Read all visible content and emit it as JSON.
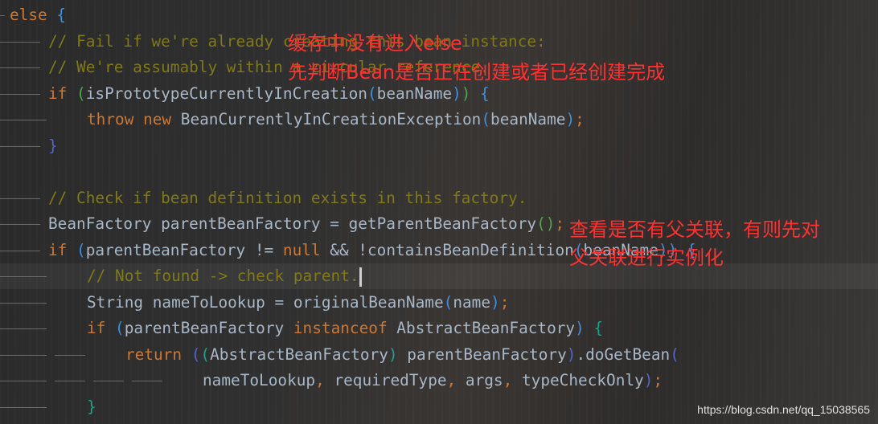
{
  "editor": {
    "current_line": 10,
    "lines": [
      {
        "indent": 0,
        "tokens": [
          [
            "kw",
            "else"
          ],
          [
            "op",
            " "
          ],
          [
            "b1",
            "{"
          ]
        ]
      },
      {
        "indent": 1,
        "tokens": [
          [
            "cm",
            "// Fail if we're already creating this bean instance:"
          ]
        ]
      },
      {
        "indent": 1,
        "tokens": [
          [
            "cm",
            "// We're assumably within a circular reference."
          ]
        ]
      },
      {
        "indent": 1,
        "tokens": [
          [
            "kw",
            "if"
          ],
          [
            "op",
            " "
          ],
          [
            "b2",
            "("
          ],
          [
            "id",
            "isPrototypeCurrentlyInCreation"
          ],
          [
            "b1",
            "("
          ],
          [
            "id",
            "beanName"
          ],
          [
            "b1",
            ")"
          ],
          [
            "b2",
            ")"
          ],
          [
            "op",
            " "
          ],
          [
            "b1",
            "{"
          ]
        ]
      },
      {
        "indent": 2,
        "tokens": [
          [
            "kw",
            "throw"
          ],
          [
            "op",
            " "
          ],
          [
            "kw",
            "new"
          ],
          [
            "op",
            " "
          ],
          [
            "id",
            "BeanCurrentlyInCreationException"
          ],
          [
            "b1",
            "("
          ],
          [
            "id",
            "beanName"
          ],
          [
            "b1",
            ")"
          ],
          [
            "pc",
            ";"
          ]
        ]
      },
      {
        "indent": 1,
        "tokens": [
          [
            "b4",
            "}"
          ]
        ]
      },
      {
        "indent": 0,
        "tokens": []
      },
      {
        "indent": 1,
        "tokens": [
          [
            "cm",
            "// Check if bean definition exists in this factory."
          ]
        ]
      },
      {
        "indent": 1,
        "tokens": [
          [
            "id",
            "BeanFactory parentBeanFactory = getParentBeanFactory"
          ],
          [
            "b2",
            "()"
          ],
          [
            "pc",
            ";"
          ]
        ]
      },
      {
        "indent": 1,
        "tokens": [
          [
            "kw",
            "if"
          ],
          [
            "op",
            " "
          ],
          [
            "b1",
            "("
          ],
          [
            "id",
            "parentBeanFactory != "
          ],
          [
            "kw",
            "null"
          ],
          [
            "id",
            " && !containsBeanDefinition"
          ],
          [
            "b1",
            "("
          ],
          [
            "id",
            "beanName"
          ],
          [
            "b1",
            "))"
          ],
          [
            "op",
            " "
          ],
          [
            "b1",
            "{"
          ]
        ]
      },
      {
        "indent": 2,
        "tokens": [
          [
            "cm",
            "// Not found -> check parent."
          ]
        ],
        "caret": true
      },
      {
        "indent": 2,
        "tokens": [
          [
            "id",
            "String nameToLookup = originalBeanName"
          ],
          [
            "b1",
            "("
          ],
          [
            "id",
            "name"
          ],
          [
            "b1",
            ")"
          ],
          [
            "pc",
            ";"
          ]
        ]
      },
      {
        "indent": 2,
        "tokens": [
          [
            "kw",
            "if"
          ],
          [
            "op",
            " "
          ],
          [
            "b1",
            "("
          ],
          [
            "id",
            "parentBeanFactory "
          ],
          [
            "kw",
            "instanceof"
          ],
          [
            "id",
            " AbstractBeanFactory"
          ],
          [
            "b1",
            ")"
          ],
          [
            "op",
            " "
          ],
          [
            "b3",
            "{"
          ]
        ]
      },
      {
        "indent": 3,
        "tokens": [
          [
            "kw",
            "return"
          ],
          [
            "op",
            " "
          ],
          [
            "b4",
            "("
          ],
          [
            "b3",
            "("
          ],
          [
            "id",
            "AbstractBeanFactory"
          ],
          [
            "b3",
            ")"
          ],
          [
            "id",
            " parentBeanFactory"
          ],
          [
            "b4",
            ")"
          ],
          [
            "id",
            ".doGetBean"
          ],
          [
            "b4",
            "("
          ]
        ]
      },
      {
        "indent": 5,
        "tokens": [
          [
            "id",
            "nameToLookup"
          ],
          [
            "pc",
            ", "
          ],
          [
            "id",
            "requiredType"
          ],
          [
            "pc",
            ", "
          ],
          [
            "id",
            "args"
          ],
          [
            "pc",
            ", "
          ],
          [
            "id",
            "typeCheckOnly"
          ],
          [
            "b4",
            ")"
          ],
          [
            "pc",
            ";"
          ]
        ]
      },
      {
        "indent": 2,
        "tokens": [
          [
            "b3",
            "}"
          ]
        ]
      }
    ]
  },
  "annotations": {
    "note1_line1": "缓存中没有进入else",
    "note1_line2": "先判断Bean是否正在创建或者已经创建完成",
    "note2_line1": "查看是否有父关联，有则先对",
    "note2_line2": "父关联进行实例化",
    "color": "#ff3030"
  },
  "watermark": "https://blog.csdn.net/qq_15038565"
}
